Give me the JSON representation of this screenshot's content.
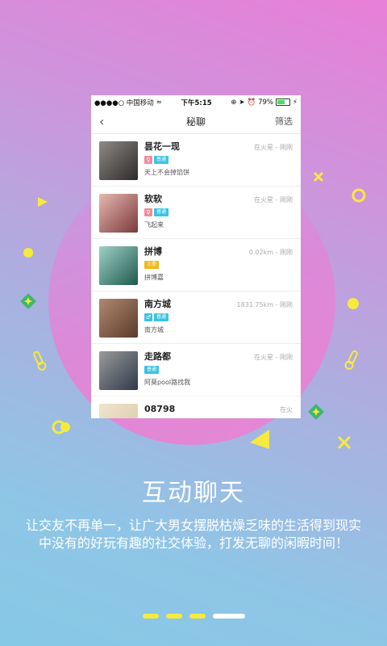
{
  "status_bar": {
    "carrier": "●●●●○ 中国移动",
    "time": "下午5:15",
    "battery": "79%",
    "battery_level": 0.79
  },
  "nav": {
    "title": "秘聊",
    "filter_label": "筛选"
  },
  "contacts": [
    {
      "name": "昙花一现",
      "badges": [
        {
          "text": "♀",
          "color": "#f28a9f"
        },
        {
          "text": "普通",
          "color": "#3bc3e6"
        }
      ],
      "signature": "天上不会掉馅饼",
      "distance": "在火星 - 刚刚",
      "avatar_colors": [
        "#2d2a2a",
        "#8e8a86"
      ]
    },
    {
      "name": "软软",
      "badges": [
        {
          "text": "♀",
          "color": "#f28a9f"
        },
        {
          "text": "普通",
          "color": "#3bc3e6"
        }
      ],
      "signature": "飞起来",
      "distance": "在火星 - 刚刚",
      "avatar_colors": [
        "#7a3a3a",
        "#e7b7b0"
      ]
    },
    {
      "name": "拼博",
      "badges": [
        {
          "text": "土豪",
          "color": "#f2b71c"
        }
      ],
      "signature": "拼博嘉",
      "distance": "0.02km - 刚刚",
      "avatar_colors": [
        "#1f5a4d",
        "#9fcfc6"
      ]
    },
    {
      "name": "南方城",
      "badges": [
        {
          "text": "♂",
          "color": "#3bc3e6"
        },
        {
          "text": "普通",
          "color": "#3bc3e6"
        }
      ],
      "signature": "南方城",
      "distance": "1831.75km - 刚刚",
      "avatar_colors": [
        "#5b3a2a",
        "#b08870"
      ]
    },
    {
      "name": "走路都",
      "badges": [
        {
          "text": "普通",
          "color": "#3bc3e6"
        }
      ],
      "signature": "阿莫pool路找我",
      "distance": "在火星 - 刚刚",
      "avatar_colors": [
        "#2e3a4a",
        "#9a9a9a"
      ]
    },
    {
      "name": "08798",
      "badges": [],
      "signature": "",
      "distance": "在火",
      "avatar_colors": [
        "#d9c8a8",
        "#efe4cc"
      ]
    }
  ],
  "headline": "互动聊天",
  "description": "让交友不再单一，让广大男女摆脱枯燥乏味的生活得到现实中没有的好玩有趣的社交体验，打发无聊的闲暇时间！",
  "pager": {
    "count": 4,
    "active_index": 3
  },
  "colors": {
    "accent_yellow": "#f7ea3e",
    "white": "#ffffff"
  }
}
